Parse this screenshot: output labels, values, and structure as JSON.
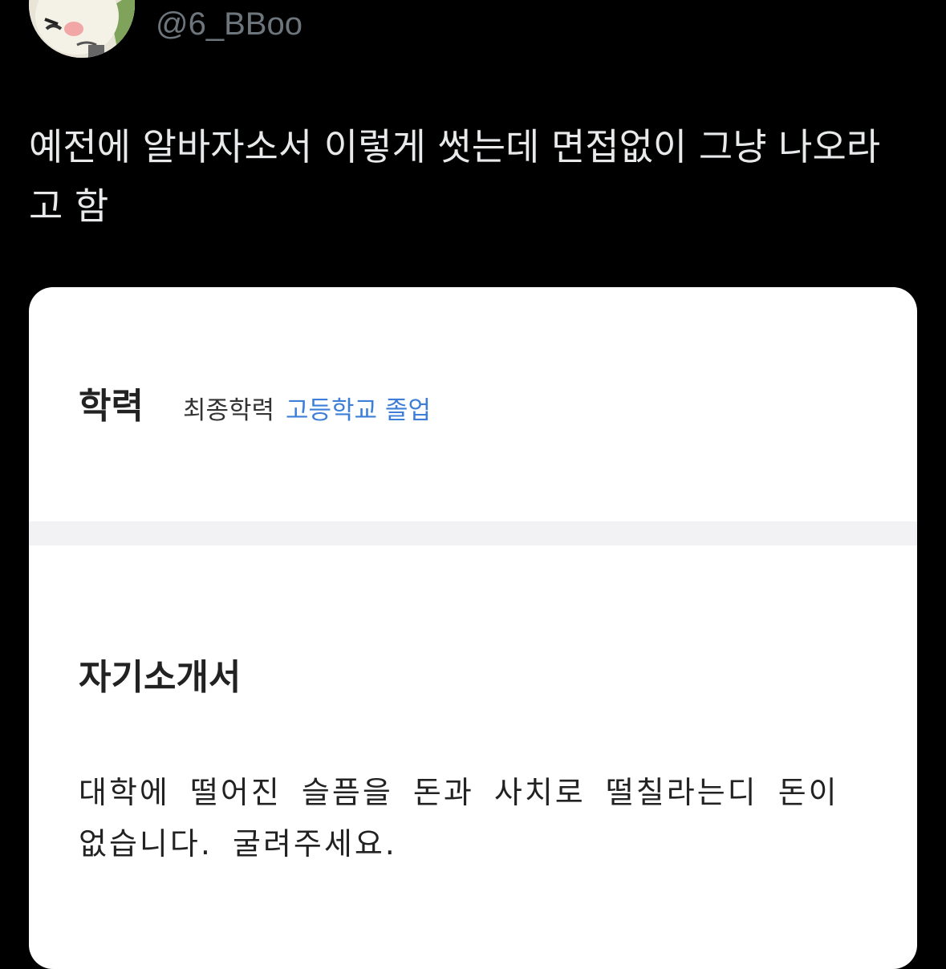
{
  "author": {
    "handle": "@6_BBoo",
    "avatar_icon": "cartoon-character-avatar"
  },
  "tweet": {
    "text": "예전에 알바자소서 이렇게 썻는데 면접없이 그냥 나오라\n고 함"
  },
  "card": {
    "education": {
      "heading": "학력",
      "label": "최종학력",
      "value": "고등학교 졸업",
      "value_color": "#3d7fd8"
    },
    "intro": {
      "heading": "자기소개서",
      "body": "대학에 떨어진 슬픔을 돈과 사치로 떨칠라는디 돈이 없습니다. 굴려주세요."
    }
  }
}
